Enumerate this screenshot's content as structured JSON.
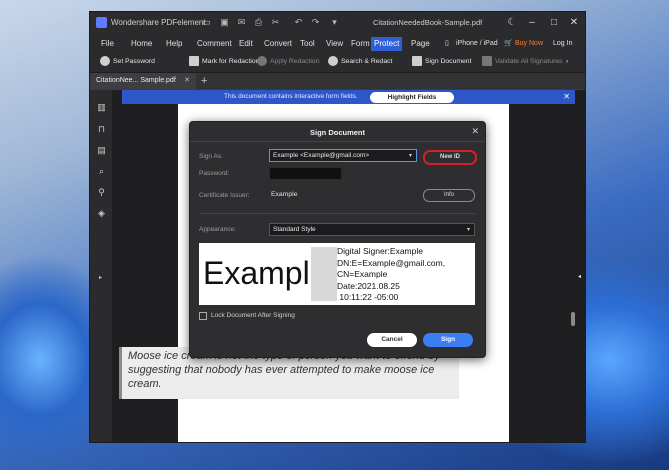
{
  "window": {
    "app_name": "Wondershare PDFelement",
    "doc_title": "CitationNeededBook-Sample.pdf"
  },
  "menu": {
    "items": [
      "File",
      "Home",
      "Help",
      "Comment",
      "Edit",
      "Convert",
      "Tool",
      "View",
      "Form",
      "Protect",
      "Page"
    ],
    "active": "Protect",
    "iphone_ipad": "iPhone / iPad",
    "buy_now": "Buy Now",
    "login": "Log In"
  },
  "toolbar": {
    "set_password": "Set Password",
    "mark_for_redaction": "Mark for Redaction",
    "apply_redaction": "Apply Redaction",
    "search_redact": "Search & Redact",
    "sign_document": "Sign Document",
    "validate_all": "Validate All Signatures"
  },
  "tab": {
    "label": "CitationNee... Sample.pdf"
  },
  "banner": {
    "text": "This document contains interactive form fields.",
    "button": "Highlight Fields"
  },
  "quote": {
    "text": "Moose ice cream is not the type of person you want to offend by suggesting that nobody has ever attempted to make moose ice cream."
  },
  "dialog": {
    "title": "Sign Document",
    "sign_as_label": "Sign As:",
    "sign_as_value": "Example <Example@gmail.com>",
    "new_id": "New ID",
    "password_label": "Password:",
    "cert_issuer_label": "Certificate Issuer:",
    "cert_issuer_value": "Example",
    "info": "Info",
    "appearance_label": "Appearance:",
    "appearance_value": "Standard Style",
    "preview": {
      "name": "Example",
      "details": "Digital Signer:Example\nDN:E=Example@gmail.com,\nCN=Example\nDate:2021.08.25\n 10:11:22 -05:00"
    },
    "lock_label": "Lock Document After Signing",
    "cancel": "Cancel",
    "sign": "Sign"
  }
}
